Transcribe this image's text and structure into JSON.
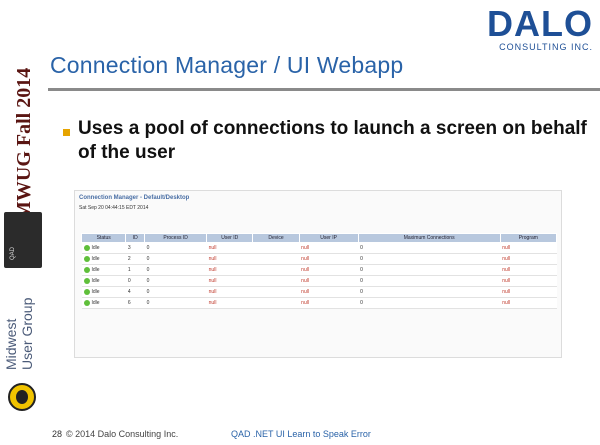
{
  "sidebar": {
    "event": "MWUG Fall 2014",
    "qad_label": "QAD",
    "group_line1": "Midwest",
    "group_line2": "User Group"
  },
  "brand": {
    "name": "DALO",
    "sub": "CONSULTING INC."
  },
  "slide": {
    "title": "Connection Manager / UI Webapp",
    "bullet": "Uses a pool of connections to launch a screen on behalf of the user"
  },
  "screenshot": {
    "title": "Connection Manager - Default/Desktop",
    "date": "Sat Sep 20 04:44:15 EDT 2014",
    "columns": [
      "Status",
      "ID",
      "Process ID",
      "User ID",
      "Device",
      "User IP",
      "Maximum Connections",
      "Program"
    ],
    "rows": [
      {
        "status": "Idle",
        "id": "3",
        "pid": "0",
        "user": "null",
        "device": "",
        "ip": "null",
        "max": "0",
        "program": "null"
      },
      {
        "status": "Idle",
        "id": "2",
        "pid": "0",
        "user": "null",
        "device": "",
        "ip": "null",
        "max": "0",
        "program": "null"
      },
      {
        "status": "Idle",
        "id": "1",
        "pid": "0",
        "user": "null",
        "device": "",
        "ip": "null",
        "max": "0",
        "program": "null"
      },
      {
        "status": "Idle",
        "id": "0",
        "pid": "0",
        "user": "null",
        "device": "",
        "ip": "null",
        "max": "0",
        "program": "null"
      },
      {
        "status": "Idle",
        "id": "4",
        "pid": "0",
        "user": "null",
        "device": "",
        "ip": "null",
        "max": "0",
        "program": "null"
      },
      {
        "status": "Idle",
        "id": "6",
        "pid": "0",
        "user": "null",
        "device": "",
        "ip": "null",
        "max": "0",
        "program": "null"
      }
    ]
  },
  "footer": {
    "page": "28",
    "copyright": "© 2014 Dalo Consulting Inc.",
    "center": "QAD .NET UI Learn to Speak Error"
  }
}
